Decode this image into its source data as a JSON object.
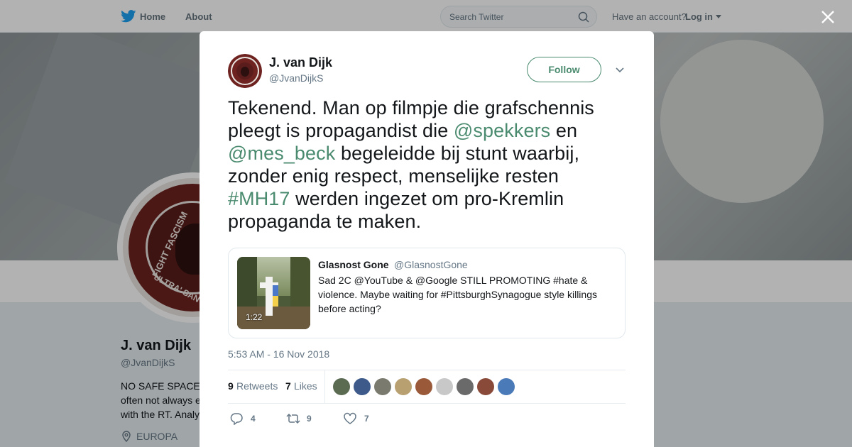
{
  "nav": {
    "home_label": "Home",
    "about_label": "About",
    "search_placeholder": "Search Twitter",
    "account_prompt": "Have an account?",
    "login_label": "Log in"
  },
  "profile": {
    "name": "J. van Dijk",
    "handle": "@JvanDijkS",
    "bio_lines": [
      "NO SAFE SPACE",
      "often not always e",
      "with the RT. Analy"
    ],
    "location": "EUROPA",
    "avatar_text_top": "FIGHT FASCISM",
    "avatar_text_bottom": "ULTRA' SANY"
  },
  "tweet": {
    "author_name": "J. van Dijk",
    "author_handle": "@JvanDijkS",
    "follow_label": "Follow",
    "text_segments": [
      {
        "text": "Tekenend. Man op filmpje die grafschennis pleegt is propagandist die ",
        "link": false
      },
      {
        "text": "@spekkers",
        "link": true
      },
      {
        "text": " en ",
        "link": false
      },
      {
        "text": "@mes_beck",
        "link": true
      },
      {
        "text": " begeleidde bij stunt waarbij, zonder enig respect, menselijke resten ",
        "link": false
      },
      {
        "text": "#MH17",
        "link": true
      },
      {
        "text": " werden ingezet om pro-Kremlin propaganda te maken.",
        "link": false
      }
    ],
    "quote": {
      "name": "Glasnost Gone",
      "handle": "@GlasnostGone",
      "text": "Sad 2C @YouTube & @Google STILL PROMOTING #hate & violence. Maybe waiting for #PittsburghSynagogue style killings before acting?",
      "video_duration": "1:22"
    },
    "timestamp": "5:53 AM - 16 Nov 2018",
    "retweets_count": "9",
    "retweets_label": "Retweets",
    "likes_count": "7",
    "likes_label": "Likes",
    "reply_count": "4",
    "retweet_action_count": "9",
    "like_action_count": "7"
  },
  "colors": {
    "link": "#4a8b6f",
    "secondary_text": "#657786",
    "twitter_blue": "#1da1f2"
  },
  "liker_avatar_colors": [
    "#5b6b52",
    "#3d5a8a",
    "#7a7a6e",
    "#b8a070",
    "#9a5a3a",
    "#c8c8c8",
    "#6a6a6a",
    "#8a4a3a",
    "#4a7ab8"
  ]
}
